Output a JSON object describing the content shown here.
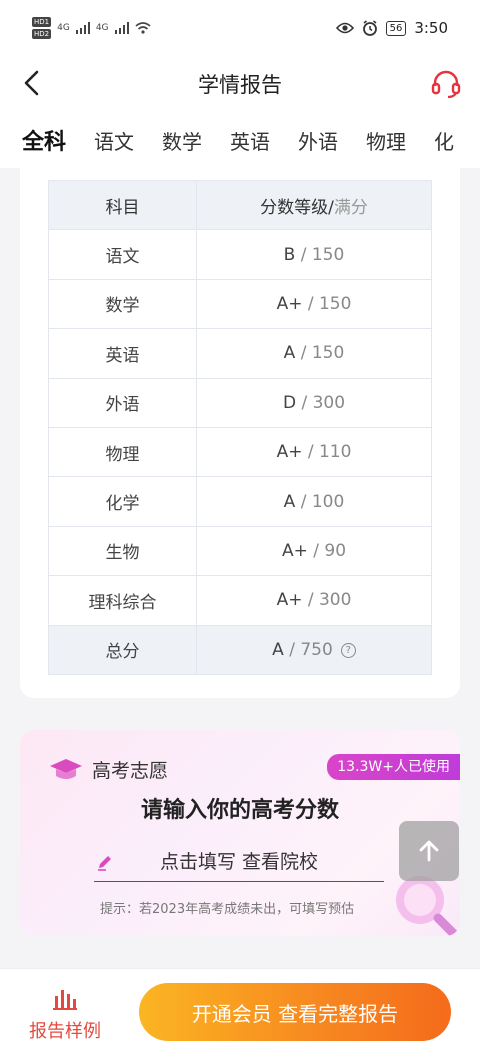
{
  "status_bar": {
    "left_badges": [
      "HD1",
      "HD2"
    ],
    "network": [
      "4G",
      "4G"
    ],
    "battery": "56",
    "time": "3:50"
  },
  "nav": {
    "title": "学情报告",
    "back_icon": "chevron-left-icon",
    "support_icon": "headset-icon"
  },
  "tabs": [
    "全科",
    "语文",
    "数学",
    "英语",
    "外语",
    "物理",
    "化"
  ],
  "tabs_active_index": 0,
  "table": {
    "header_subject": "科目",
    "header_score": "分数等级/",
    "header_full": "满分",
    "rows": [
      {
        "subject": "语文",
        "grade": "B",
        "full": "/ 150"
      },
      {
        "subject": "数学",
        "grade": "A+",
        "full": "/ 150"
      },
      {
        "subject": "英语",
        "grade": "A",
        "full": "/ 150"
      },
      {
        "subject": "外语",
        "grade": "D",
        "full": "/ 300"
      },
      {
        "subject": "物理",
        "grade": "A+",
        "full": "/ 110"
      },
      {
        "subject": "化学",
        "grade": "A",
        "full": "/ 100"
      },
      {
        "subject": "生物",
        "grade": "A+",
        "full": "/ 90"
      },
      {
        "subject": "理科综合",
        "grade": "A+",
        "full": "/ 300"
      }
    ],
    "total": {
      "subject": "总分",
      "grade": "A",
      "full": "/ 750",
      "help": "?"
    }
  },
  "gaokao": {
    "label": "高考志愿",
    "badge": "13.3W+人已使用",
    "headline": "请输入你的高考分数",
    "input_placeholder": "点击填写 查看院校",
    "tip": "提示：若2023年高考成绩未出，可填写预估"
  },
  "bottom": {
    "sample_label": "报告样例",
    "cta_label": "开通会员 查看完整报告"
  },
  "colors": {
    "accent_red": "#e8323c",
    "cta_orange": "#f78a20",
    "badge_magenta": "#d945c8"
  }
}
